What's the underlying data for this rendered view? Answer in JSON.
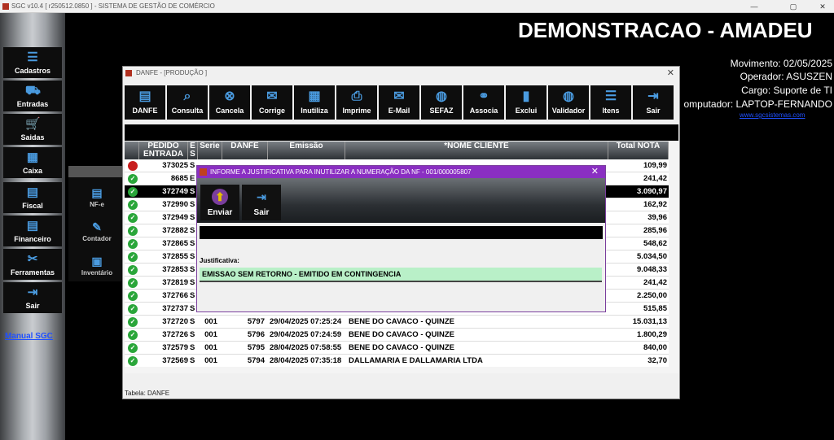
{
  "app_title": "SGC v10.4 [ r250512.0850 ] - SISTEMA DE GESTÃO DE COMÉRCIO",
  "sidebar": {
    "items": [
      {
        "label": "Cadastros",
        "icon": "cadastros-icon",
        "glyph": "☰"
      },
      {
        "label": "Entradas",
        "icon": "truck-icon",
        "glyph": "⛟"
      },
      {
        "label": "Saidas",
        "icon": "cart-icon",
        "glyph": "🛒"
      },
      {
        "label": "Caixa",
        "icon": "cash-register-icon",
        "glyph": "▦"
      },
      {
        "label": "Fiscal",
        "icon": "fiscal-doc-icon",
        "glyph": "▤"
      },
      {
        "label": "Financeiro",
        "icon": "finance-doc-icon",
        "glyph": "▤"
      },
      {
        "label": "Ferramentas",
        "icon": "tools-icon",
        "glyph": "✂"
      },
      {
        "label": "Sair",
        "icon": "exit-icon",
        "glyph": "⇥"
      }
    ],
    "manual": "Manual SGC"
  },
  "subpanel": {
    "items": [
      {
        "label": "NF-e",
        "icon": "nfe-doc-icon",
        "glyph": "▤"
      },
      {
        "label": "Contador",
        "icon": "accountant-icon",
        "glyph": "✎"
      },
      {
        "label": "Inventário",
        "icon": "inventory-icon",
        "glyph": "▣"
      }
    ]
  },
  "header": {
    "company": "DEMONSTRACAO - AMADEU",
    "movimento": "Movimento: 02/05/2025",
    "operador": "Operador: ASUSZEN",
    "cargo": "Cargo: Suporte de TI",
    "computador": "omputador: LAPTOP-FERNANDO",
    "website": "www.sgcsistemas.com"
  },
  "danfe_window": {
    "title": "DANFE - [PRODUÇÃO   ]",
    "toolbar": [
      {
        "label": "DANFE",
        "icon": "danfe-icon",
        "glyph": "▤"
      },
      {
        "label": "Consulta",
        "icon": "search-icon",
        "glyph": "⌕"
      },
      {
        "label": "Cancela",
        "icon": "cancel-icon",
        "glyph": "⊗"
      },
      {
        "label": "Corrige",
        "icon": "mail-icon",
        "glyph": "✉"
      },
      {
        "label": "Inutiliza",
        "icon": "calculator-icon",
        "glyph": "▦"
      },
      {
        "label": "Imprime",
        "icon": "printer-icon",
        "glyph": "⎙"
      },
      {
        "label": "E-Mail",
        "icon": "email-icon",
        "glyph": "✉"
      },
      {
        "label": "SEFAZ",
        "icon": "globe-icon",
        "glyph": "◍"
      },
      {
        "label": "Associa",
        "icon": "link-icon",
        "glyph": "⚭"
      },
      {
        "label": "Exclui",
        "icon": "trash-icon",
        "glyph": "▮"
      },
      {
        "label": "Validador",
        "icon": "validator-globe-icon",
        "glyph": "◍"
      },
      {
        "label": "Itens",
        "icon": "list-icon",
        "glyph": "☰"
      },
      {
        "label": "Sair",
        "icon": "exit-door-icon",
        "glyph": "⇥"
      }
    ],
    "columns": [
      "PEDIDO ENTRADA",
      "E S",
      "Serie",
      "DANFE",
      "Emissão",
      "*NOME CLIENTE",
      "Total NOTA"
    ],
    "rows": [
      {
        "status": "red",
        "pedido": "373025",
        "es": "S",
        "serie": "",
        "danfe": "",
        "emissao": "",
        "cliente": "",
        "total": "109,99"
      },
      {
        "status": "green",
        "pedido": "8685",
        "es": "E",
        "serie": "",
        "danfe": "",
        "emissao": "",
        "cliente": "",
        "total": "241,42"
      },
      {
        "status": "green",
        "pedido": "372749",
        "es": "S",
        "serie": "",
        "danfe": "",
        "emissao": "",
        "cliente": "",
        "total": "3.090,97",
        "selected": true
      },
      {
        "status": "green",
        "pedido": "372990",
        "es": "S",
        "serie": "",
        "danfe": "",
        "emissao": "",
        "cliente": "",
        "total": "162,92"
      },
      {
        "status": "green",
        "pedido": "372949",
        "es": "S",
        "serie": "",
        "danfe": "",
        "emissao": "",
        "cliente": "",
        "total": "39,96"
      },
      {
        "status": "green",
        "pedido": "372882",
        "es": "S",
        "serie": "",
        "danfe": "",
        "emissao": "",
        "cliente": "",
        "total": "285,96"
      },
      {
        "status": "green",
        "pedido": "372865",
        "es": "S",
        "serie": "",
        "danfe": "",
        "emissao": "",
        "cliente": "",
        "total": "548,62"
      },
      {
        "status": "green",
        "pedido": "372855",
        "es": "S",
        "serie": "",
        "danfe": "",
        "emissao": "",
        "cliente": "",
        "total": "5.034,50"
      },
      {
        "status": "green",
        "pedido": "372853",
        "es": "S",
        "serie": "",
        "danfe": "",
        "emissao": "",
        "cliente": "",
        "total": "9.048,33"
      },
      {
        "status": "green",
        "pedido": "372819",
        "es": "S",
        "serie": "",
        "danfe": "",
        "emissao": "",
        "cliente": "",
        "total": "241,42"
      },
      {
        "status": "green",
        "pedido": "372766",
        "es": "S",
        "serie": "",
        "danfe": "",
        "emissao": "",
        "cliente": "",
        "total": "2.250,00"
      },
      {
        "status": "green",
        "pedido": "372737",
        "es": "S",
        "serie": "",
        "danfe": "",
        "emissao": "",
        "cliente": "",
        "total": "515,85"
      },
      {
        "status": "green",
        "pedido": "372720",
        "es": "S",
        "serie": "001",
        "danfe": "5797",
        "emissao": "29/04/2025 07:25:24",
        "cliente": "BENE DO CAVACO - QUINZE",
        "total": "15.031,13"
      },
      {
        "status": "green",
        "pedido": "372726",
        "es": "S",
        "serie": "001",
        "danfe": "5796",
        "emissao": "29/04/2025 07:24:59",
        "cliente": "BENE DO CAVACO - QUINZE",
        "total": "1.800,29"
      },
      {
        "status": "green",
        "pedido": "372579",
        "es": "S",
        "serie": "001",
        "danfe": "5795",
        "emissao": "28/04/2025 07:58:55",
        "cliente": "BENE DO CAVACO - QUINZE",
        "total": "840,00"
      },
      {
        "status": "green",
        "pedido": "372569",
        "es": "S",
        "serie": "001",
        "danfe": "5794",
        "emissao": "28/04/2025 07:35:18",
        "cliente": "DALLAMARIA E DALLAMARIA LTDA",
        "total": "32,70"
      }
    ],
    "status_bar": "Tabela: DANFE"
  },
  "dialog": {
    "title": "INFORME A JUSTIFICATIVA PARA INUTILIZAR A NUMERAÇÃO DA NF - 001/000005807",
    "send_label": "Enviar",
    "exit_label": "Sair",
    "justificativa_label": "Justificativa:",
    "justificativa_value": "EMISSAO SEM RETORNO - EMITIDO EM CONTINGENCIA"
  }
}
